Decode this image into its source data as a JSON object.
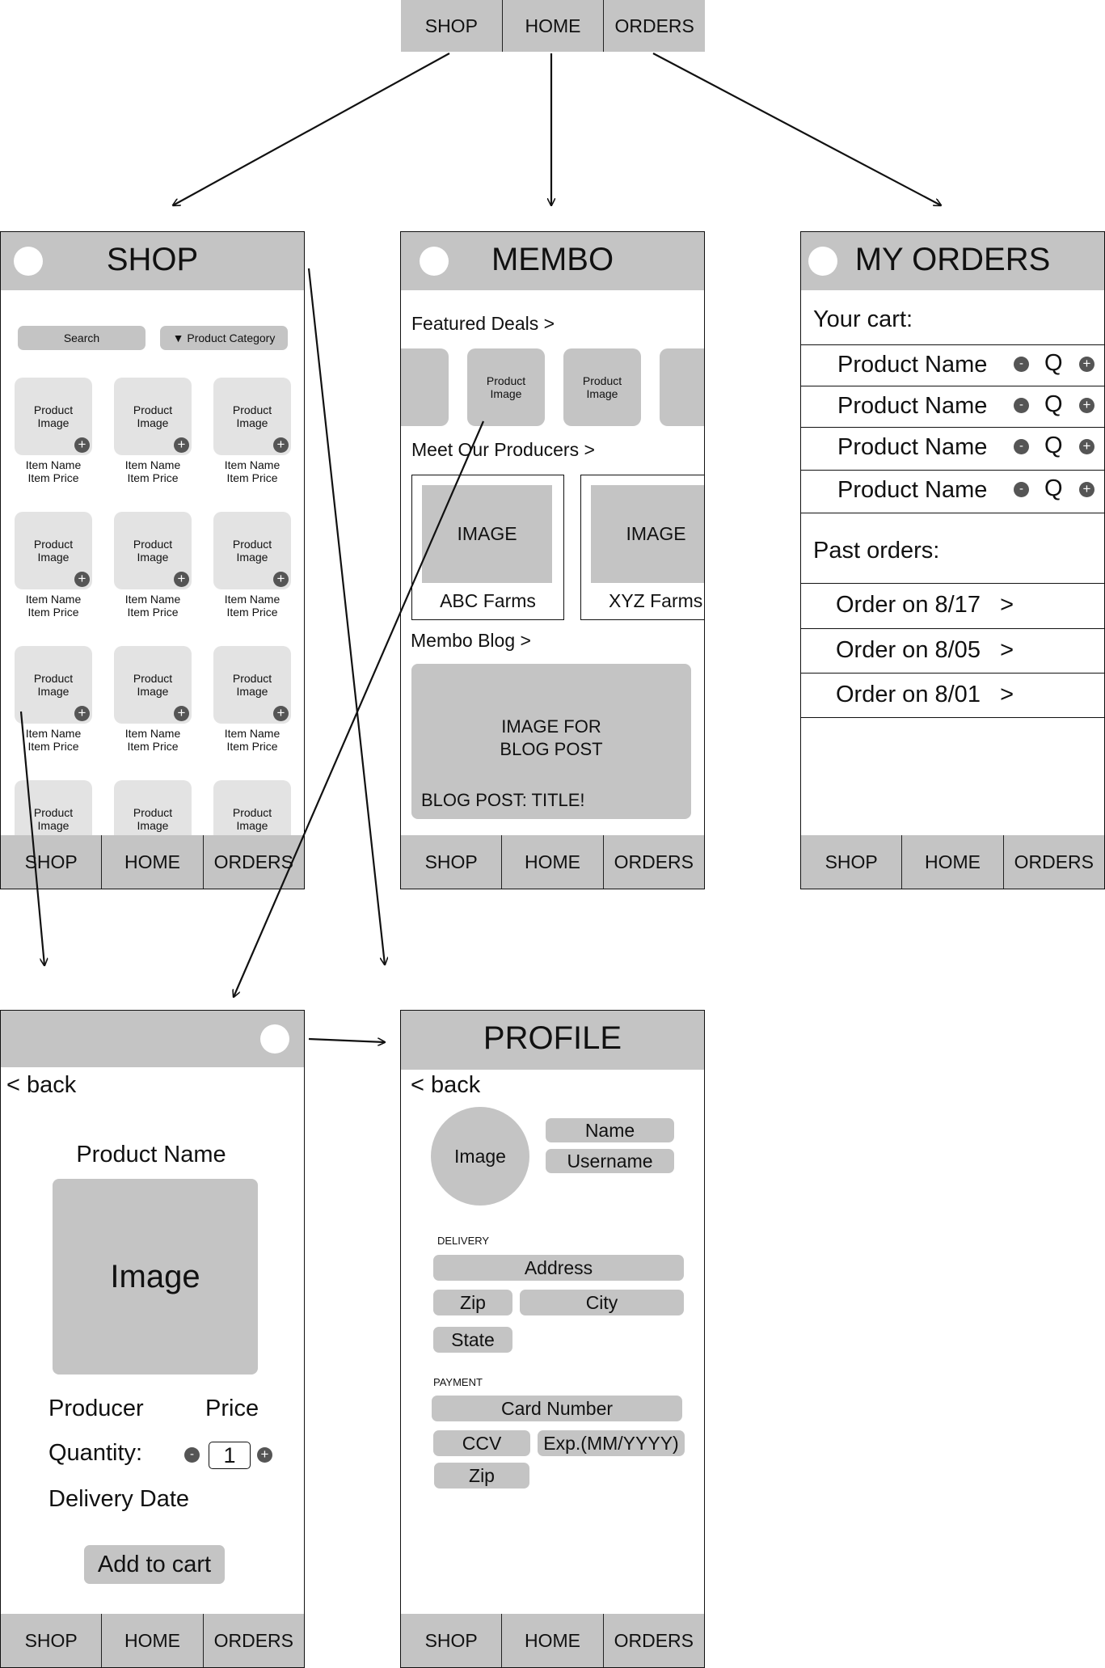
{
  "nav": [
    "SHOP",
    "HOME",
    "ORDERS"
  ],
  "shop": {
    "title": "SHOP",
    "search": "Search",
    "category": "Product Category",
    "tile_line1": "Product",
    "tile_line2": "Image",
    "item_name": "Item Name",
    "item_price": "Item Price",
    "plus": "+"
  },
  "home": {
    "title": "MEMBO",
    "featured": "Featured Deals  >",
    "producers_heading": "Meet Our Producers  >",
    "producer_image": "IMAGE",
    "producers": [
      "ABC Farms",
      "XYZ Farms"
    ],
    "blog_heading": "Membo Blog >",
    "blog_image_line1": "IMAGE FOR",
    "blog_image_line2": "BLOG POST",
    "blog_title": "BLOG POST: TITLE!"
  },
  "orders": {
    "title": "MY ORDERS",
    "cart_heading": "Your cart:",
    "cart_item": "Product Name",
    "minus": "-",
    "qty": "Q",
    "plus": "+",
    "past_heading": "Past orders:",
    "past": [
      "Order on 8/17   >",
      "Order on 8/05   >",
      "Order on 8/01   >"
    ]
  },
  "product": {
    "back": "< back",
    "name": "Product Name",
    "image": "Image",
    "producer": "Producer",
    "price": "Price",
    "quantity_label": "Quantity:",
    "minus": "-",
    "quantity_value": "1",
    "plus": "+",
    "delivery": "Delivery Date",
    "add_to_cart": "Add to cart"
  },
  "profile": {
    "title": "PROFILE",
    "back": "< back",
    "image": "Image",
    "name": "Name",
    "username": "Username",
    "delivery_label": "DELIVERY",
    "address": "Address",
    "zip": "Zip",
    "city": "City",
    "state": "State",
    "payment_label": "PAYMENT",
    "card": "Card Number",
    "ccv": "CCV",
    "exp": "Exp.(MM/YYYY)",
    "zip2": "Zip"
  }
}
